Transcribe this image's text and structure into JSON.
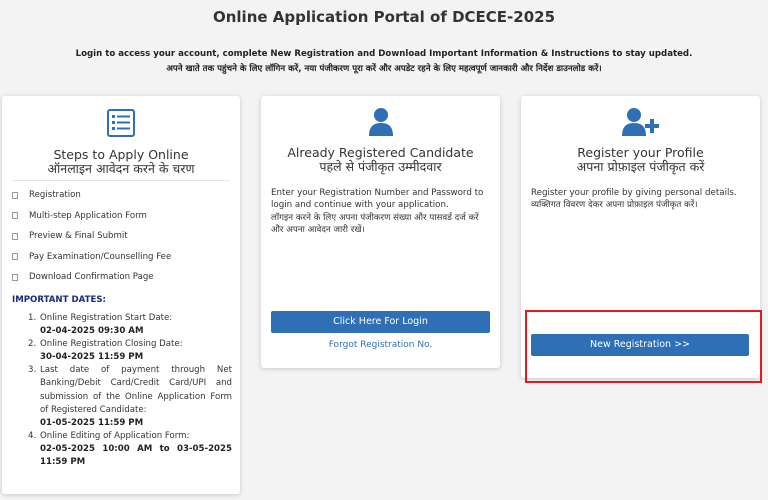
{
  "page": {
    "title": "Online Application Portal of DCECE-2025",
    "subtitle_en": "Login to access your account, complete New Registration and Download Important Information & Instructions to stay updated.",
    "subtitle_hi": "अपने खाते तक पहुंचने के लिए लॉगिन करें, नया पंजीकरण पूरा करें और अपडेट रहने के लिए महत्वपूर्ण जानकारी और निर्देश डाउनलोड करें।"
  },
  "steps_card": {
    "icon": "checklist-icon",
    "heading_en": "Steps to Apply Online",
    "heading_hi": "ऑनलाइन आवेदन करने के चरण",
    "steps": [
      "Registration",
      "Multi-step Application Form",
      "Preview & Final Submit",
      "Pay Examination/Counselling Fee",
      "Download Confirmation Page"
    ],
    "important_title": "IMPORTANT DATES:",
    "dates": [
      {
        "num": "1.",
        "label": "Online Registration Start Date:",
        "value": "02-04-2025 09:30 AM"
      },
      {
        "num": "2.",
        "label": "Online Registration Closing Date:",
        "value": "30-04-2025 11:59 PM"
      },
      {
        "num": "3.",
        "label": "Last date of payment through Net Banking/Debit Card/Credit Card/UPI and submission of the Online Application Form of Registered Candidate:",
        "value": "01-05-2025 11:59 PM"
      },
      {
        "num": "4.",
        "label": "Online Editing of Application Form:",
        "value": "02-05-2025 10:00 AM to 03-05-2025 11:59 PM"
      }
    ]
  },
  "login_card": {
    "icon": "user-icon",
    "heading_en": "Already Registered Candidate",
    "heading_hi": "पहले से पंजीकृत उम्मीदवार",
    "desc_en": "Enter your Registration Number and Password to login and continue with your application.",
    "desc_hi": "लॉगइन करने के लिए अपना पंजीकरण संख्या और पासवर्ड दर्ज करें और अपना आवेदन जारी रखें।",
    "button": "Click Here For Login",
    "link": "Forgot Registration No."
  },
  "register_card": {
    "icon": "user-plus-icon",
    "heading_en": "Register your Profile",
    "heading_hi": "अपना प्रोफ़ाइल पंजीकृत करें",
    "desc_en": "Register your profile by giving personal details.",
    "desc_hi": "व्यक्तिगत विवरण देकर अपना प्रोफ़ाइल पंजीकृत करें।",
    "button": "New Registration >>"
  },
  "colors": {
    "accent": "#2f6fb5",
    "highlight": "#e01b1b",
    "important": "#1a2a7a"
  }
}
